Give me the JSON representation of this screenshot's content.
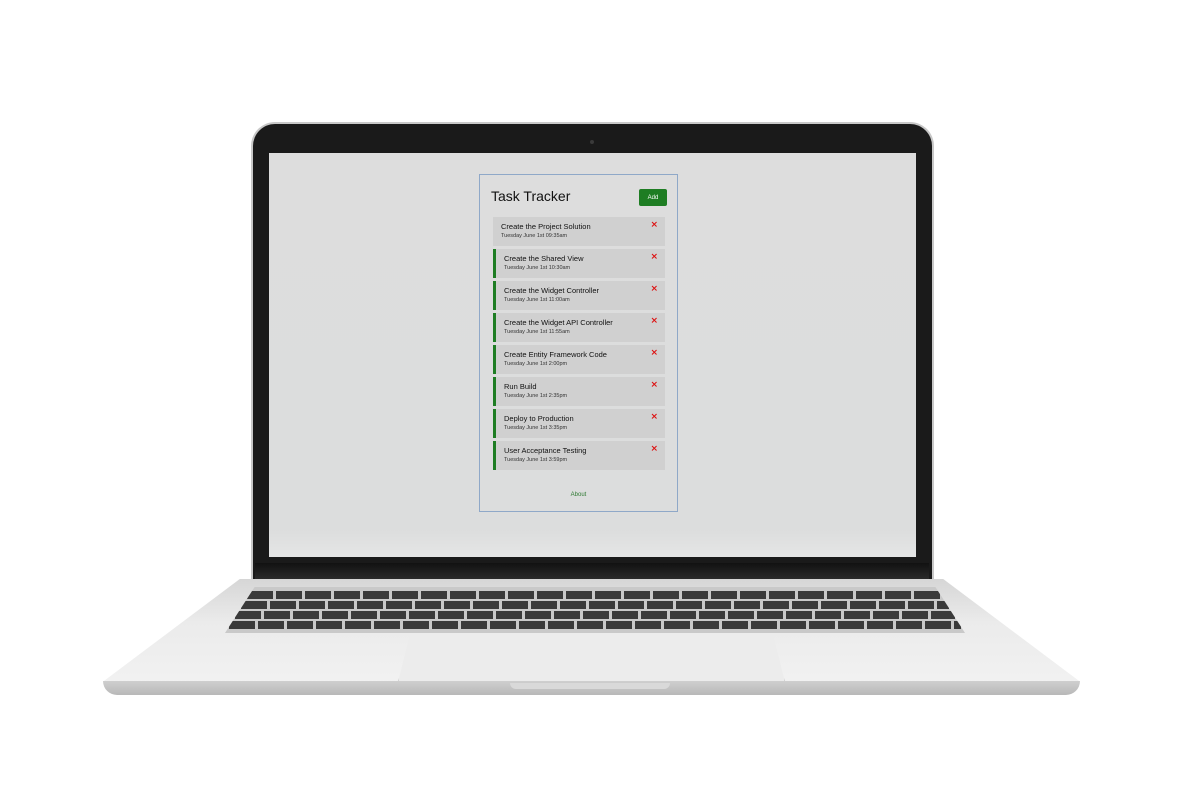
{
  "app": {
    "title": "Task Tracker",
    "add_label": "Add",
    "about_label": "About",
    "accent_color": "#1e7d23",
    "delete_color": "#dd1111",
    "delete_icon": "×"
  },
  "tasks": [
    {
      "name": "Create the Project Solution",
      "date": "Tuesday June 1st 09:35am",
      "reminder": false
    },
    {
      "name": "Create the Shared View",
      "date": "Tuesday June 1st 10:30am",
      "reminder": true
    },
    {
      "name": "Create the Widget Controller",
      "date": "Tuesday June 1st 11:00am",
      "reminder": true
    },
    {
      "name": "Create the Widget API Controller",
      "date": "Tuesday June 1st 11:55am",
      "reminder": true
    },
    {
      "name": "Create Entity Framework Code",
      "date": "Tuesday June 1st 2:00pm",
      "reminder": true
    },
    {
      "name": "Run Build",
      "date": "Tuesday June 1st 2:35pm",
      "reminder": true
    },
    {
      "name": "Deploy to Production",
      "date": "Tuesday June 1st 3:35pm",
      "reminder": true
    },
    {
      "name": "User Acceptance Testing",
      "date": "Tuesday June 1st 3:59pm",
      "reminder": true
    }
  ]
}
